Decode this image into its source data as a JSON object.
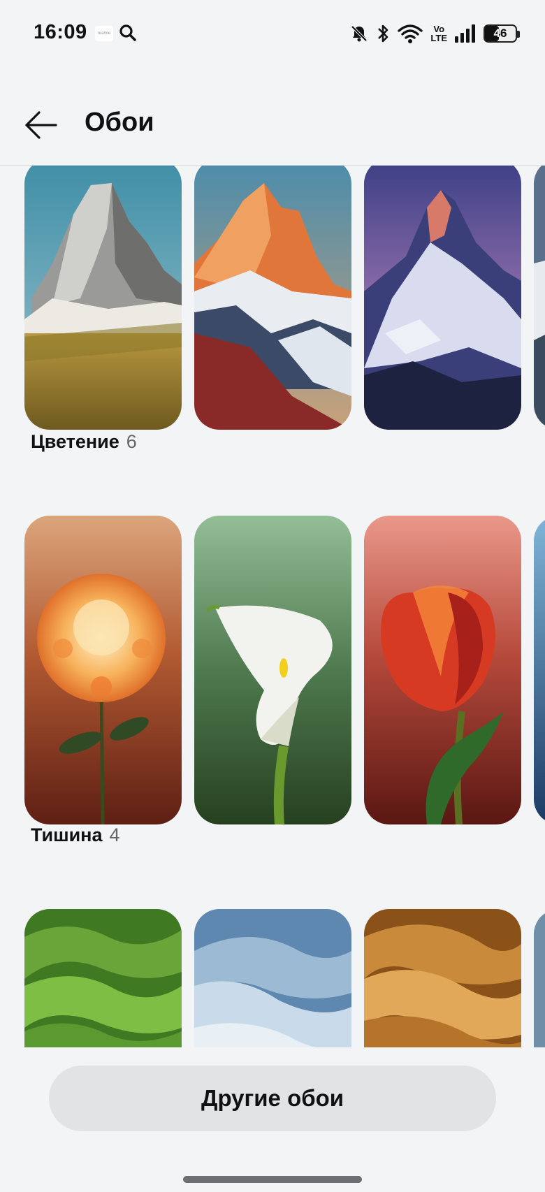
{
  "status_bar": {
    "time": "16:09",
    "notif_app": "realme",
    "volte": [
      "Vo",
      "LTE"
    ],
    "battery": "46",
    "battery_level": 0.46
  },
  "header": {
    "title": "Обои"
  },
  "sections": [
    {
      "title": "Цветение",
      "count": "6"
    },
    {
      "title": "Тишина",
      "count": "4"
    }
  ],
  "bottom": {
    "button_label": "Другие обои"
  },
  "colors": {
    "background": "#f3f4f6",
    "button": "#e2e3e5"
  }
}
